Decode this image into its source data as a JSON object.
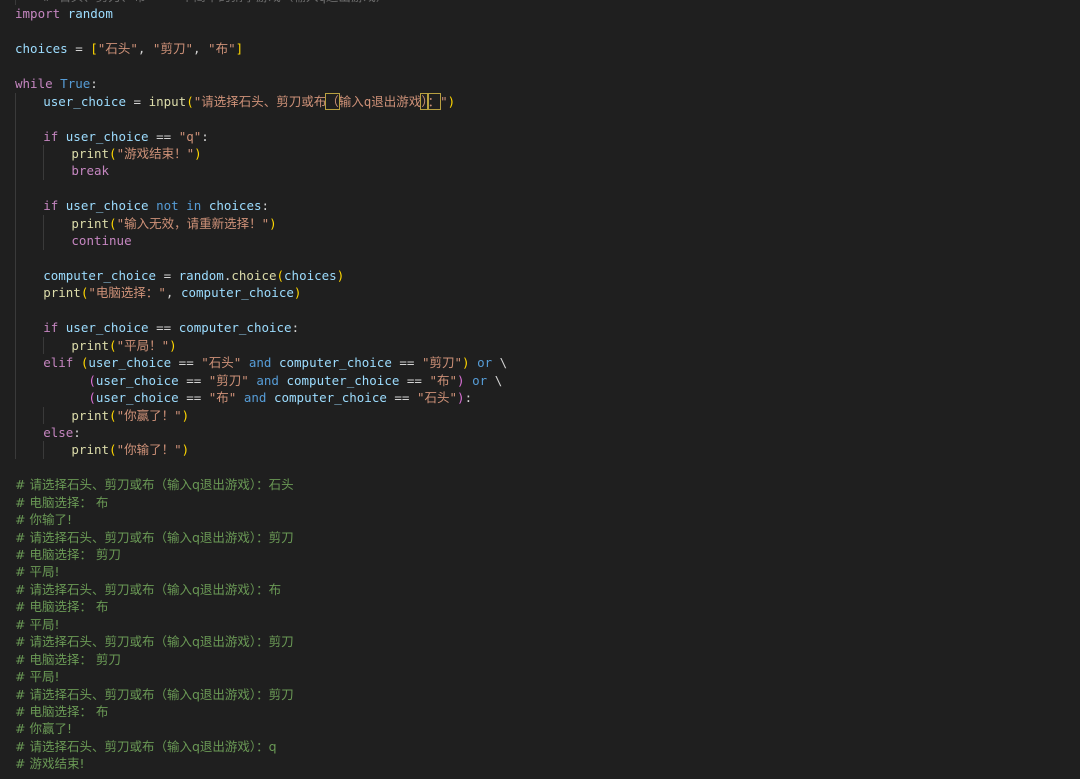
{
  "code_lines": [
    {
      "indent": 1,
      "tokens": [
        [
          "faint",
          "# 石头、剪刀、布 — 一个简单的猜拳游戏（输入q退出游戏）"
        ]
      ]
    },
    {
      "indent": 0,
      "tokens": [
        [
          "kw",
          "import"
        ],
        [
          "op",
          " "
        ],
        [
          "v",
          "random"
        ]
      ]
    },
    {
      "indent": 0,
      "tokens": []
    },
    {
      "indent": 0,
      "tokens": [
        [
          "v",
          "choices"
        ],
        [
          "op",
          " = "
        ],
        [
          "br",
          "["
        ],
        [
          "st",
          "\"石头\""
        ],
        [
          "op",
          ", "
        ],
        [
          "st",
          "\"剪刀\""
        ],
        [
          "op",
          ", "
        ],
        [
          "st",
          "\"布\""
        ],
        [
          "br",
          "]"
        ]
      ]
    },
    {
      "indent": 0,
      "tokens": []
    },
    {
      "indent": 0,
      "tokens": [
        [
          "kw",
          "while"
        ],
        [
          "op",
          " "
        ],
        [
          "kb",
          "True"
        ],
        [
          "op",
          ":"
        ]
      ]
    },
    {
      "indent": 1,
      "tokens": [
        [
          "v",
          "user_choice"
        ],
        [
          "op",
          " = "
        ],
        [
          "fn",
          "input"
        ],
        [
          "br",
          "("
        ],
        [
          "st",
          "\"请选择石头、剪刀或布"
        ],
        [
          "sthl",
          "（"
        ],
        [
          "st",
          "输入q退出游戏"
        ],
        [
          "sthl",
          "）"
        ],
        [
          "sthl",
          "："
        ],
        [
          "st",
          "\""
        ],
        [
          "br",
          ")"
        ]
      ]
    },
    {
      "indent": 1,
      "tokens": []
    },
    {
      "indent": 1,
      "tokens": [
        [
          "kw",
          "if"
        ],
        [
          "op",
          " "
        ],
        [
          "v",
          "user_choice"
        ],
        [
          "op",
          " == "
        ],
        [
          "st",
          "\"q\""
        ],
        [
          "op",
          ":"
        ]
      ]
    },
    {
      "indent": 2,
      "tokens": [
        [
          "fn",
          "print"
        ],
        [
          "br",
          "("
        ],
        [
          "st",
          "\"游戏结束！\""
        ],
        [
          "br",
          ")"
        ]
      ]
    },
    {
      "indent": 2,
      "tokens": [
        [
          "kw",
          "break"
        ]
      ]
    },
    {
      "indent": 1,
      "tokens": []
    },
    {
      "indent": 1,
      "tokens": [
        [
          "kw",
          "if"
        ],
        [
          "op",
          " "
        ],
        [
          "v",
          "user_choice"
        ],
        [
          "op",
          " "
        ],
        [
          "kb",
          "not"
        ],
        [
          "op",
          " "
        ],
        [
          "kb",
          "in"
        ],
        [
          "op",
          " "
        ],
        [
          "v",
          "choices"
        ],
        [
          "op",
          ":"
        ]
      ]
    },
    {
      "indent": 2,
      "tokens": [
        [
          "fn",
          "print"
        ],
        [
          "br",
          "("
        ],
        [
          "st",
          "\"输入无效，请重新选择！\""
        ],
        [
          "br",
          ")"
        ]
      ]
    },
    {
      "indent": 2,
      "tokens": [
        [
          "kw",
          "continue"
        ]
      ]
    },
    {
      "indent": 1,
      "tokens": []
    },
    {
      "indent": 1,
      "tokens": [
        [
          "v",
          "computer_choice"
        ],
        [
          "op",
          " = "
        ],
        [
          "v",
          "random"
        ],
        [
          "op",
          "."
        ],
        [
          "fn",
          "choice"
        ],
        [
          "br",
          "("
        ],
        [
          "v",
          "choices"
        ],
        [
          "br",
          ")"
        ]
      ]
    },
    {
      "indent": 1,
      "tokens": [
        [
          "fn",
          "print"
        ],
        [
          "br",
          "("
        ],
        [
          "st",
          "\"电脑选择：\""
        ],
        [
          "op",
          ", "
        ],
        [
          "v",
          "computer_choice"
        ],
        [
          "br",
          ")"
        ]
      ]
    },
    {
      "indent": 1,
      "tokens": []
    },
    {
      "indent": 1,
      "tokens": [
        [
          "kw",
          "if"
        ],
        [
          "op",
          " "
        ],
        [
          "v",
          "user_choice"
        ],
        [
          "op",
          " == "
        ],
        [
          "v",
          "computer_choice"
        ],
        [
          "op",
          ":"
        ]
      ]
    },
    {
      "indent": 2,
      "tokens": [
        [
          "fn",
          "print"
        ],
        [
          "br",
          "("
        ],
        [
          "st",
          "\"平局！\""
        ],
        [
          "br",
          ")"
        ]
      ]
    },
    {
      "indent": 1,
      "tokens": [
        [
          "kw",
          "elif"
        ],
        [
          "op",
          " "
        ],
        [
          "br",
          "("
        ],
        [
          "v",
          "user_choice"
        ],
        [
          "op",
          " == "
        ],
        [
          "st",
          "\"石头\""
        ],
        [
          "op",
          " "
        ],
        [
          "kb",
          "and"
        ],
        [
          "op",
          " "
        ],
        [
          "v",
          "computer_choice"
        ],
        [
          "op",
          " == "
        ],
        [
          "st",
          "\"剪刀\""
        ],
        [
          "br",
          ")"
        ],
        [
          "op",
          " "
        ],
        [
          "kb",
          "or"
        ],
        [
          "op",
          " \\"
        ]
      ]
    },
    {
      "indent": 1,
      "extra": "      ",
      "tokens": [
        [
          "br2",
          "("
        ],
        [
          "v",
          "user_choice"
        ],
        [
          "op",
          " == "
        ],
        [
          "st",
          "\"剪刀\""
        ],
        [
          "op",
          " "
        ],
        [
          "kb",
          "and"
        ],
        [
          "op",
          " "
        ],
        [
          "v",
          "computer_choice"
        ],
        [
          "op",
          " == "
        ],
        [
          "st",
          "\"布\""
        ],
        [
          "br2",
          ")"
        ],
        [
          "op",
          " "
        ],
        [
          "kb",
          "or"
        ],
        [
          "op",
          " \\"
        ]
      ]
    },
    {
      "indent": 1,
      "extra": "      ",
      "tokens": [
        [
          "br2",
          "("
        ],
        [
          "v",
          "user_choice"
        ],
        [
          "op",
          " == "
        ],
        [
          "st",
          "\"布\""
        ],
        [
          "op",
          " "
        ],
        [
          "kb",
          "and"
        ],
        [
          "op",
          " "
        ],
        [
          "v",
          "computer_choice"
        ],
        [
          "op",
          " == "
        ],
        [
          "st",
          "\"石头\""
        ],
        [
          "br2",
          ")"
        ],
        [
          "op",
          ":"
        ]
      ]
    },
    {
      "indent": 2,
      "tokens": [
        [
          "fn",
          "print"
        ],
        [
          "br",
          "("
        ],
        [
          "st",
          "\"你赢了！\""
        ],
        [
          "br",
          ")"
        ]
      ]
    },
    {
      "indent": 1,
      "tokens": [
        [
          "kw",
          "else"
        ],
        [
          "op",
          ":"
        ]
      ]
    },
    {
      "indent": 2,
      "tokens": [
        [
          "fn",
          "print"
        ],
        [
          "br",
          "("
        ],
        [
          "st",
          "\"你输了！\""
        ],
        [
          "br",
          ")"
        ]
      ]
    },
    {
      "indent": 0,
      "tokens": []
    },
    {
      "indent": 0,
      "tokens": [
        [
          "cm",
          "# 请选择石头、剪刀或布（输入q退出游戏）：石头"
        ]
      ]
    },
    {
      "indent": 0,
      "tokens": [
        [
          "cm",
          "# 电脑选择： 布"
        ]
      ]
    },
    {
      "indent": 0,
      "tokens": [
        [
          "cm",
          "# 你输了!"
        ]
      ]
    },
    {
      "indent": 0,
      "tokens": [
        [
          "cm",
          "# 请选择石头、剪刀或布（输入q退出游戏）：剪刀"
        ]
      ]
    },
    {
      "indent": 0,
      "tokens": [
        [
          "cm",
          "# 电脑选择： 剪刀"
        ]
      ]
    },
    {
      "indent": 0,
      "tokens": [
        [
          "cm",
          "# 平局!"
        ]
      ]
    },
    {
      "indent": 0,
      "tokens": [
        [
          "cm",
          "# 请选择石头、剪刀或布（输入q退出游戏）：布"
        ]
      ]
    },
    {
      "indent": 0,
      "tokens": [
        [
          "cm",
          "# 电脑选择： 布"
        ]
      ]
    },
    {
      "indent": 0,
      "tokens": [
        [
          "cm",
          "# 平局!"
        ]
      ]
    },
    {
      "indent": 0,
      "tokens": [
        [
          "cm",
          "# 请选择石头、剪刀或布（输入q退出游戏）：剪刀"
        ]
      ]
    },
    {
      "indent": 0,
      "tokens": [
        [
          "cm",
          "# 电脑选择： 剪刀"
        ]
      ]
    },
    {
      "indent": 0,
      "tokens": [
        [
          "cm",
          "# 平局!"
        ]
      ]
    },
    {
      "indent": 0,
      "tokens": [
        [
          "cm",
          "# 请选择石头、剪刀或布（输入q退出游戏）：剪刀"
        ]
      ]
    },
    {
      "indent": 0,
      "tokens": [
        [
          "cm",
          "# 电脑选择： 布"
        ]
      ]
    },
    {
      "indent": 0,
      "tokens": [
        [
          "cm",
          "# 你赢了!"
        ]
      ]
    },
    {
      "indent": 0,
      "tokens": [
        [
          "cm",
          "# 请选择石头、剪刀或布（输入q退出游戏）：q"
        ]
      ]
    },
    {
      "indent": 0,
      "tokens": [
        [
          "cm",
          "# 游戏结束!"
        ]
      ]
    }
  ]
}
